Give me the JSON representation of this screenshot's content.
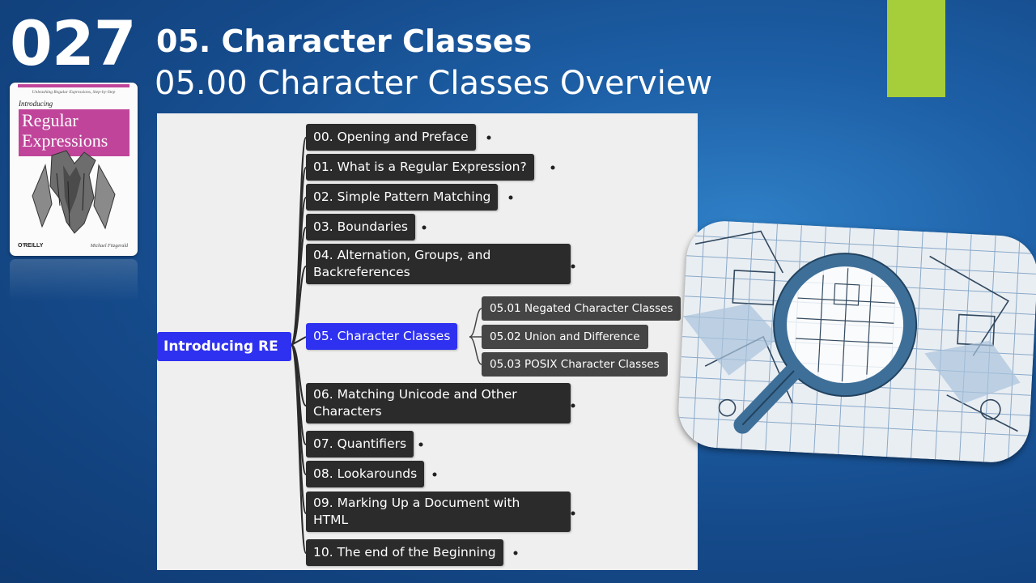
{
  "slide_number": "027",
  "title": "05. Character Classes",
  "subtitle": "05.00 Character Classes Overview",
  "book": {
    "tagline": "Unleashing Regular Expressions, Step-by-Step",
    "intro": "Introducing",
    "title_line1": "Regular",
    "title_line2": "Expressions",
    "publisher": "O'REILLY",
    "author": "Michael Fitzgerald"
  },
  "mindmap": {
    "root": "Introducing RE",
    "nodes": [
      "00. Opening and Preface",
      "01. What is a Regular Expression?",
      "02. Simple Pattern Matching",
      "03. Boundaries",
      [
        "04. Alternation, Groups, and",
        "Backreferences"
      ],
      "05. Character Classes",
      [
        "06. Matching Unicode and Other",
        "Characters"
      ],
      "07. Quantifiers",
      "08. Lookarounds",
      [
        "09. Marking Up a Document with",
        "HTML"
      ],
      "10. The end of the Beginning"
    ],
    "subnodes": [
      "05.01 Negated Character Classes",
      "05.02 Union and Difference",
      "05.03 POSIX Character Classes"
    ]
  },
  "colors": {
    "accent": "#a6cd3a",
    "active": "#2f31f0",
    "node": "#2b2b2b",
    "subnode": "#454545"
  }
}
